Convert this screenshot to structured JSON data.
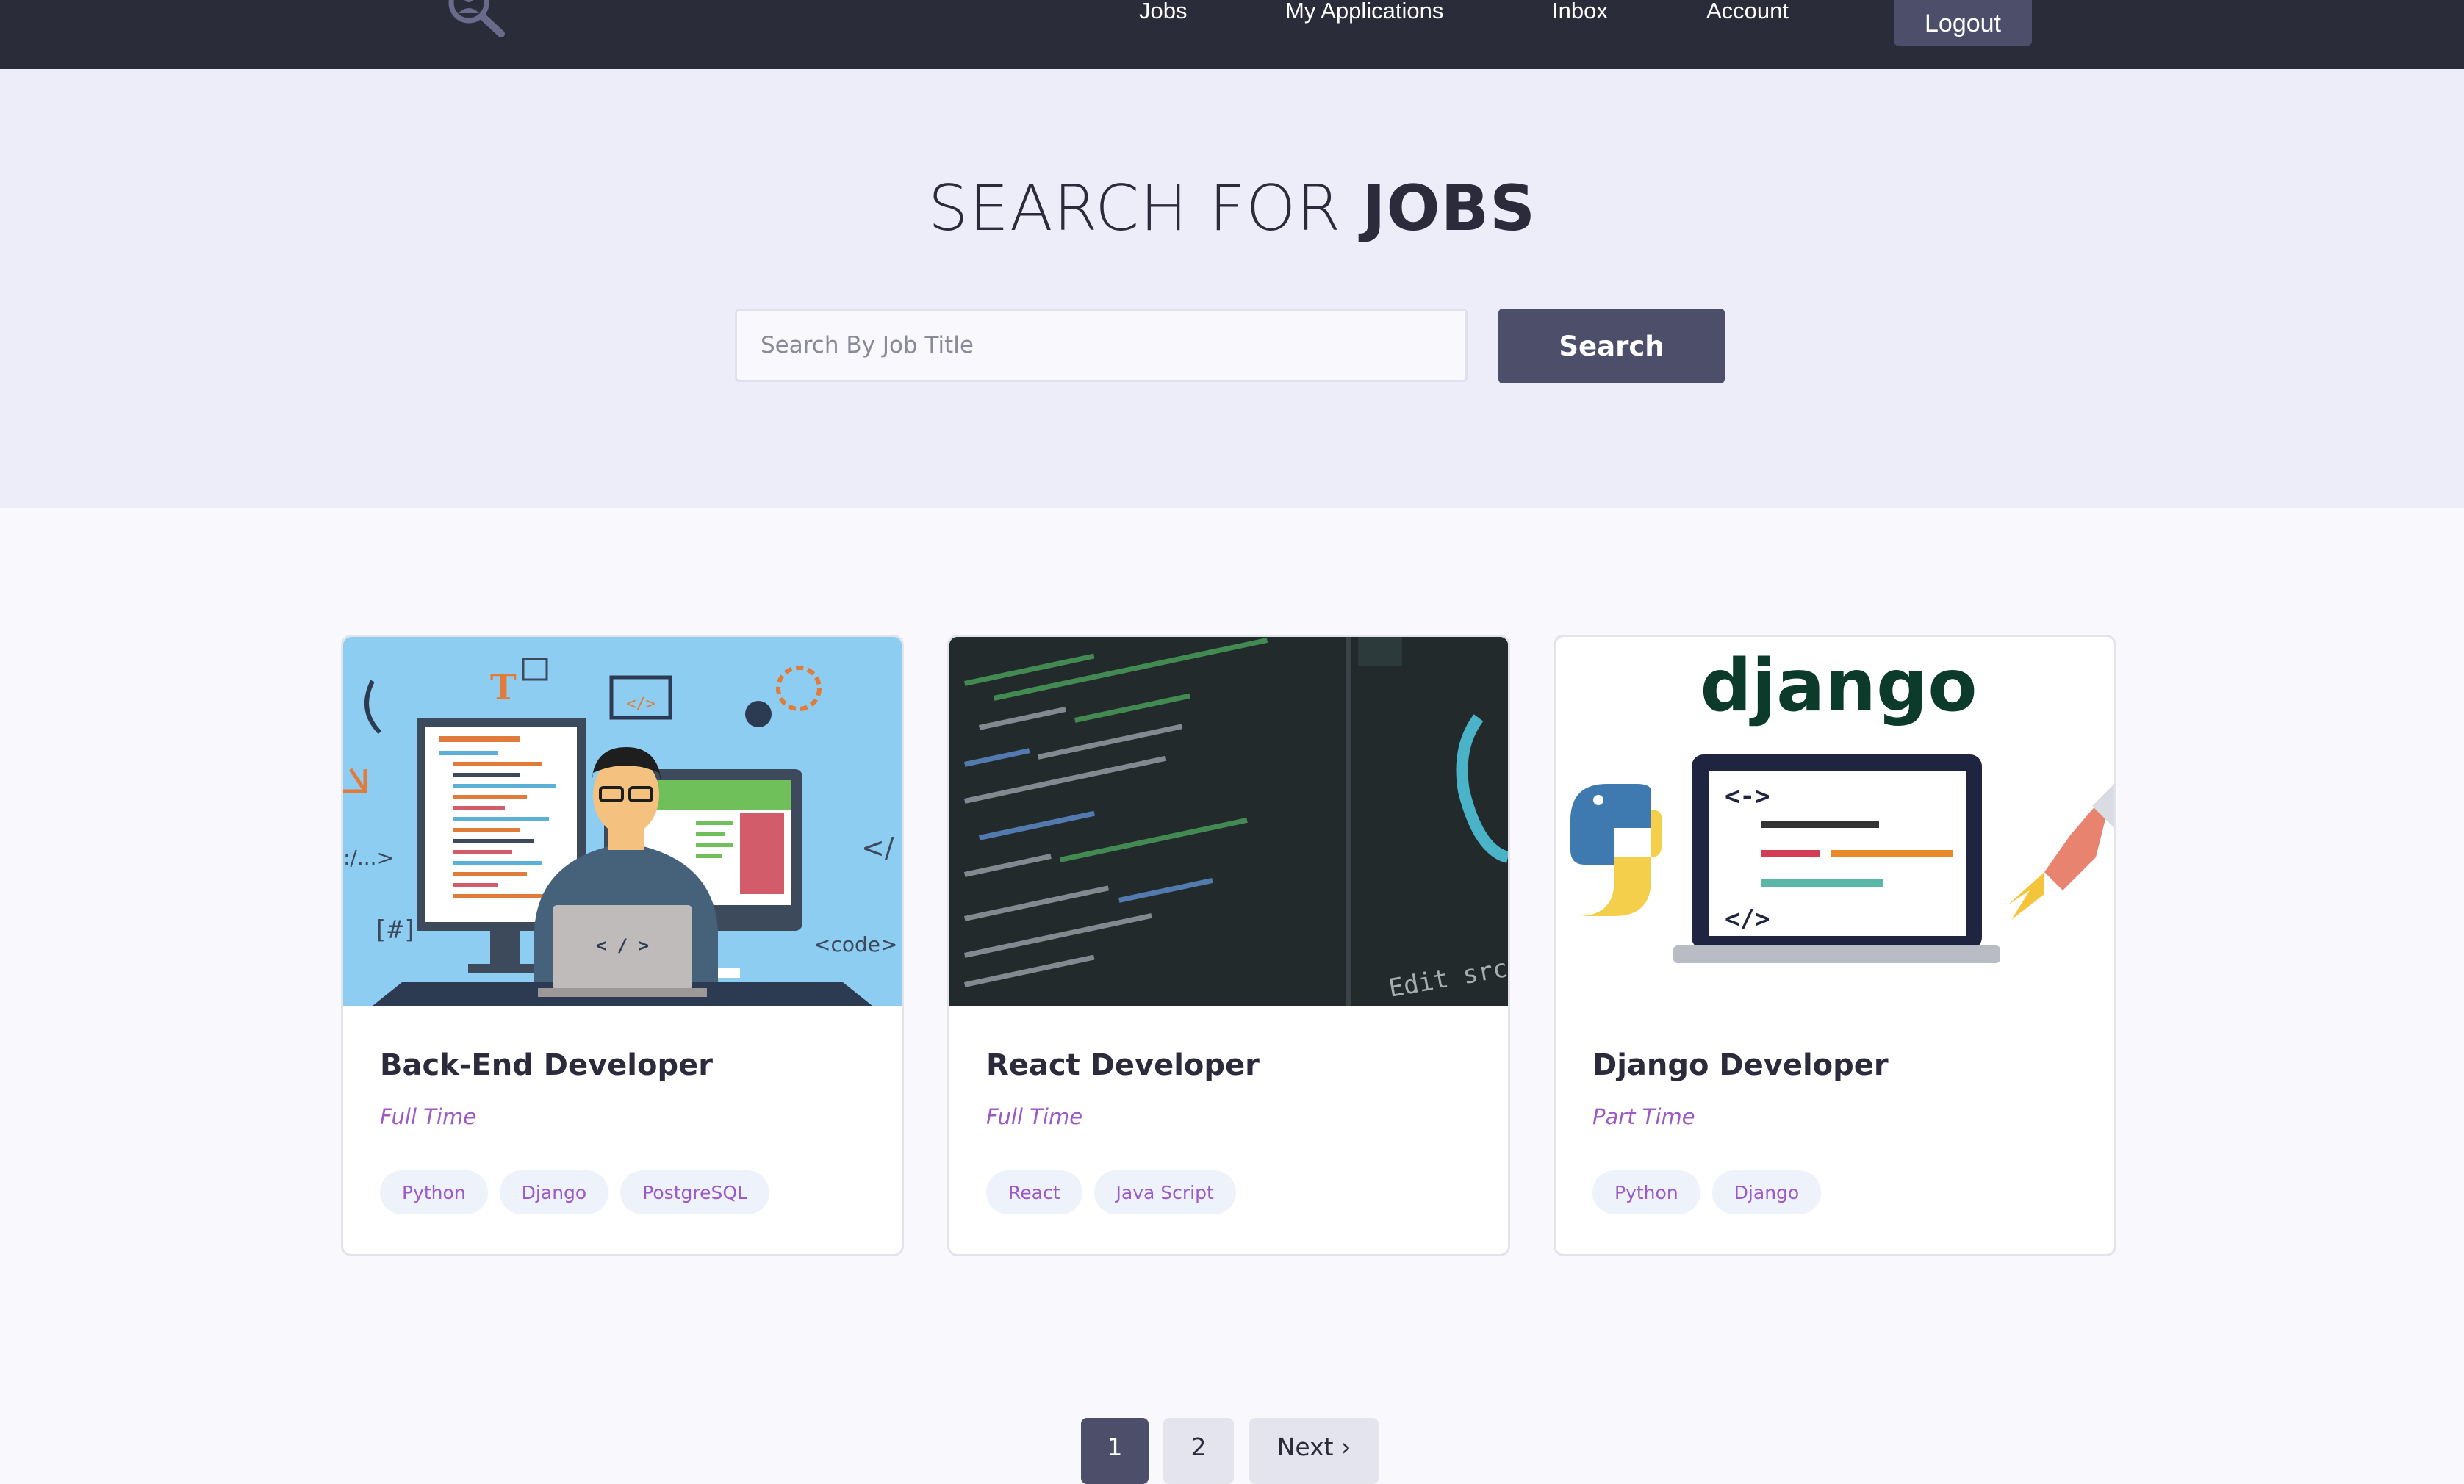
{
  "navbar": {
    "links": {
      "jobs": "Jobs",
      "applications": "My Applications",
      "inbox": "Inbox",
      "account": "Account"
    },
    "logout_label": "Logout",
    "logo_icon": "search-person-icon"
  },
  "hero": {
    "title_light": "SEARCH FOR ",
    "title_bold": "JOBS",
    "search": {
      "placeholder": "Search By Job Title",
      "value": "",
      "button_label": "Search"
    }
  },
  "jobs": [
    {
      "title": "Back-End Developer",
      "type": "Full Time",
      "tags": [
        "Python",
        "Django",
        "PostgreSQL"
      ],
      "image_icon": "developer-illustration"
    },
    {
      "title": "React Developer",
      "type": "Full Time",
      "tags": [
        "React",
        "Java Script"
      ],
      "image_icon": "code-screen-photo",
      "image_text": "Edit src/App"
    },
    {
      "title": "Django Developer",
      "type": "Part Time",
      "tags": [
        "Python",
        "Django"
      ],
      "image_icon": "django-laptop-illustration",
      "image_text": "django"
    }
  ],
  "pagination": {
    "pages": [
      "1",
      "2"
    ],
    "current": "1",
    "next_label": "Next ›"
  },
  "colors": {
    "navbar": "#2b2c39",
    "hero": "#ededfa",
    "accent": "#4d4f6a",
    "tag_text": "#9b5ac5"
  }
}
